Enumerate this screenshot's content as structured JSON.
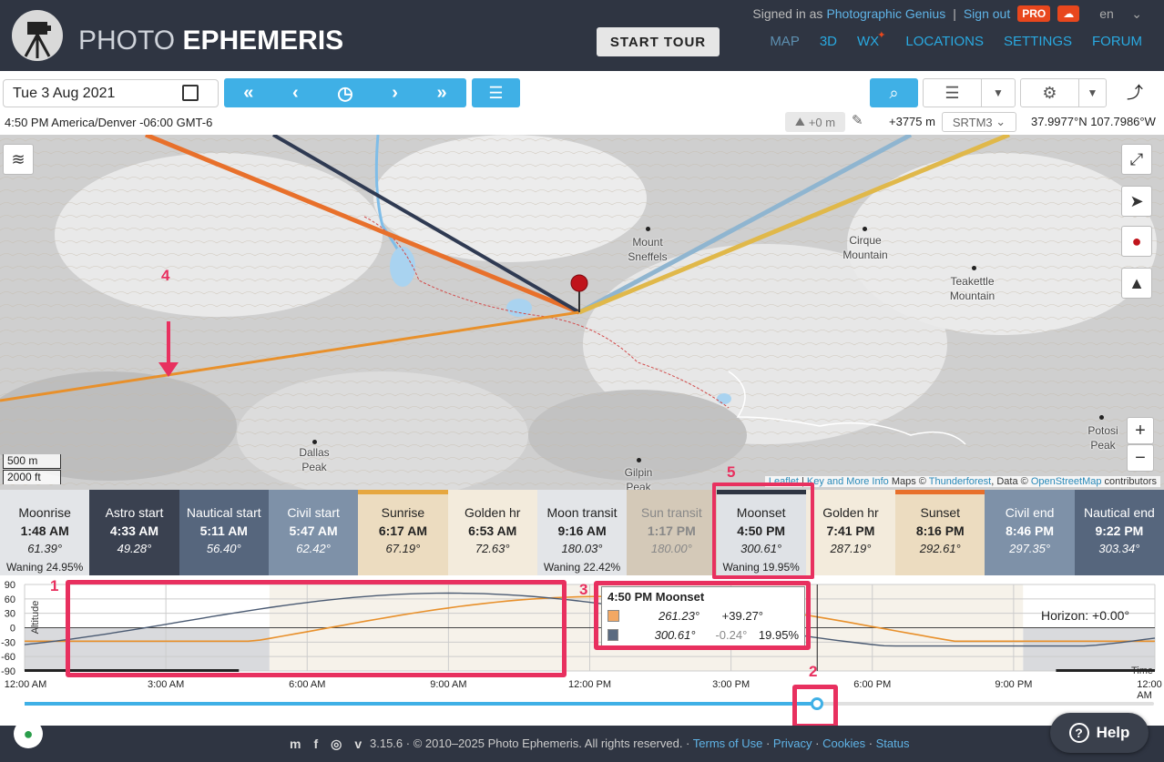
{
  "header": {
    "brand_light": "PHOTO",
    "brand_bold": "EPHEMERIS",
    "start_tour": "START TOUR",
    "signed_in_prefix": "Signed in as",
    "user_name": "Photographic Genius",
    "sign_out": "Sign out",
    "pro_badge": "PRO",
    "lang": "en",
    "nav": [
      "MAP",
      "3D",
      "WX",
      "LOCATIONS",
      "SETTINGS",
      "FORUM"
    ]
  },
  "toolbar": {
    "date": "Tue 3 Aug 2021",
    "time_line": "4:50 PM America/Denver -06:00 GMT-6",
    "elev_offset": "+0 m",
    "elevation": "+3775 m",
    "dem": "SRTM3",
    "coords": "37.9977°N 107.7986°W"
  },
  "map": {
    "places": [
      {
        "name": "Mount\nSneffels"
      },
      {
        "name": "Cirque\nMountain"
      },
      {
        "name": "Teakettle\nMountain"
      },
      {
        "name": "Dallas\nPeak"
      },
      {
        "name": "Gilpin\nPeak"
      },
      {
        "name": "Potosi\nPeak"
      }
    ],
    "scale_m": "500 m",
    "scale_ft": "2000 ft",
    "attribution": {
      "leaflet": "Leaflet",
      "sep": " | ",
      "key": "Key and More Info",
      "maps": " Maps © ",
      "tf": "Thunderforest",
      "data": ", Data © ",
      "osm": "OpenStreetMap",
      "tail": " contributors"
    },
    "zoom_in": "+",
    "zoom_out": "−"
  },
  "events": [
    {
      "name": "Moonrise",
      "time": "1:48 AM",
      "az": "61.39°",
      "extra": "Waning 24.95%",
      "bg": "#e3e5e8",
      "fg": "#222",
      "top": "#e3e5e8"
    },
    {
      "name": "Astro start",
      "time": "4:33 AM",
      "az": "49.28°",
      "extra": "",
      "bg": "#3a4150",
      "fg": "#fff",
      "top": "#3a4150"
    },
    {
      "name": "Nautical start",
      "time": "5:11 AM",
      "az": "56.40°",
      "extra": "",
      "bg": "#56667d",
      "fg": "#fff",
      "top": "#56667d"
    },
    {
      "name": "Civil start",
      "time": "5:47 AM",
      "az": "62.42°",
      "extra": "",
      "bg": "#7e91a8",
      "fg": "#fff",
      "top": "#7e91a8"
    },
    {
      "name": "Sunrise",
      "time": "6:17 AM",
      "az": "67.19°",
      "extra": "",
      "bg": "#ecdcc0",
      "fg": "#222",
      "top": "#e6a740"
    },
    {
      "name": "Golden hr",
      "time": "6:53 AM",
      "az": "72.63°",
      "extra": "",
      "bg": "#f3ebdc",
      "fg": "#222",
      "top": "#f3ebdc"
    },
    {
      "name": "Moon transit",
      "time": "9:16 AM",
      "az": "180.03°",
      "extra": "Waning 22.42%",
      "bg": "#e3e5e8",
      "fg": "#222",
      "top": "#e3e5e8"
    },
    {
      "name": "Sun transit",
      "time": "1:17 PM",
      "az": "180.00°",
      "extra": "",
      "bg": "#d4c9b8",
      "fg": "#888",
      "top": "#d4c9b8"
    },
    {
      "name": "Moonset",
      "time": "4:50 PM",
      "az": "300.61°",
      "extra": "Waning 19.95%",
      "bg": "#dfe2e6",
      "fg": "#222",
      "top": "#2f3542"
    },
    {
      "name": "Golden hr",
      "time": "7:41 PM",
      "az": "287.19°",
      "extra": "",
      "bg": "#f3ebdc",
      "fg": "#222",
      "top": "#f3ebdc"
    },
    {
      "name": "Sunset",
      "time": "8:16 PM",
      "az": "292.61°",
      "extra": "",
      "bg": "#ecdcc0",
      "fg": "#222",
      "top": "#e8702b"
    },
    {
      "name": "Civil end",
      "time": "8:46 PM",
      "az": "297.35°",
      "extra": "",
      "bg": "#7e91a8",
      "fg": "#fff",
      "top": "#7e91a8"
    },
    {
      "name": "Nautical end",
      "time": "9:22 PM",
      "az": "303.34°",
      "extra": "",
      "bg": "#56667d",
      "fg": "#fff",
      "top": "#56667d"
    }
  ],
  "chart": {
    "yticks": [
      "90",
      "60",
      "30",
      "0",
      "-30",
      "-60",
      "-90"
    ],
    "ylabel": "Altitude",
    "xlabel": "Time",
    "xticks": [
      "12:00 AM",
      "3:00 AM",
      "6:00 AM",
      "9:00 AM",
      "12:00 PM",
      "3:00 PM",
      "6:00 PM",
      "9:00 PM",
      "12:00 AM"
    ],
    "horizon": "Horizon: +0.00°",
    "tooltip": {
      "title": "4:50 PM Moonset",
      "rows": [
        {
          "color": "#f3a864",
          "az": "261.23°",
          "alt": "+39.27°",
          "phase": ""
        },
        {
          "color": "#5a6a80",
          "az": "300.61°",
          "alt": "-0.24°",
          "phase": "19.95%"
        }
      ]
    },
    "sun_color": "#e8902b",
    "moon_color": "#4a5a72",
    "slider_percent": 70
  },
  "annotations": [
    "1",
    "2",
    "3",
    "4",
    "5"
  ],
  "footer": {
    "version": "3.15.6 · © 2010–2025 Photo Ephemeris. All rights reserved. ·",
    "terms": "Terms of Use",
    "privacy": "Privacy",
    "cookies": "Cookies",
    "status": "Status",
    "help": "Help"
  }
}
